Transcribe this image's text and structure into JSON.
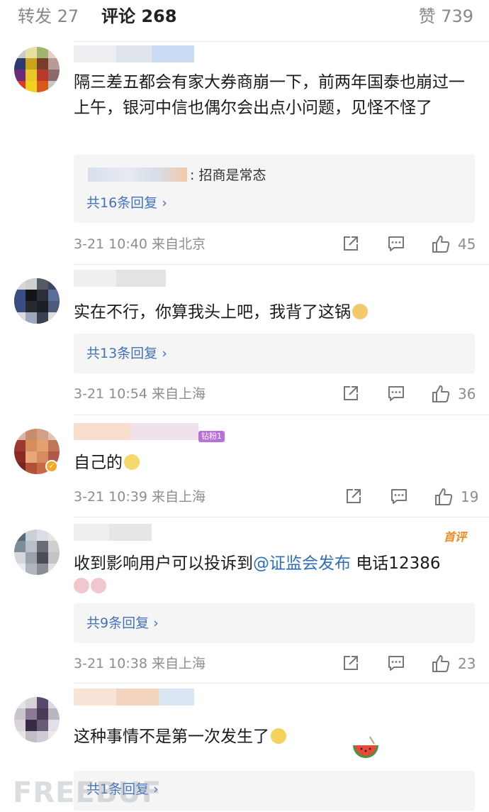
{
  "tabs": {
    "repost": "转发 27",
    "comments": "评论 268",
    "likes": "赞 739"
  },
  "comments": [
    {
      "text": "隔三差五都会有家大券商崩一下，前两年国泰也崩过一上午，银河中信也偶尔会出点小问题，见怪不怪了",
      "reply_quote": ": 招商是常态",
      "reply_more": "共16条回复",
      "time": "3-21 10:40",
      "location": "来自北京",
      "likes": "45"
    },
    {
      "text": "实在不行，你算我头上吧，我背了这锅",
      "reply_more": "共13条回复",
      "time": "3-21 10:54",
      "location": "来自上海",
      "likes": "36"
    },
    {
      "text": "自己的",
      "fan_badge": "钻粉1",
      "time": "3-21 10:39",
      "location": "来自上海",
      "likes": "19"
    },
    {
      "text_before": "收到影响用户可以投诉到",
      "mention": "@证监会发布",
      "text_after": " 电话12386",
      "first_tag": "首评",
      "reply_more": "共9条回复",
      "time": "3-21 10:38",
      "location": "来自上海",
      "likes": "23"
    },
    {
      "text": "这种事情不是第一次发生了",
      "reply_more": "共1条回复"
    }
  ],
  "icons": {
    "share": "share-icon",
    "comment": "comment-icon",
    "like": "thumbs-up-icon",
    "chevron": "chevron-right-icon"
  },
  "watermark": "FREEBUF",
  "colors": {
    "link": "#4471b8",
    "meta": "#8d8d8d",
    "reply_bg": "#f5f5f5",
    "first_tag": "#f08a23"
  }
}
